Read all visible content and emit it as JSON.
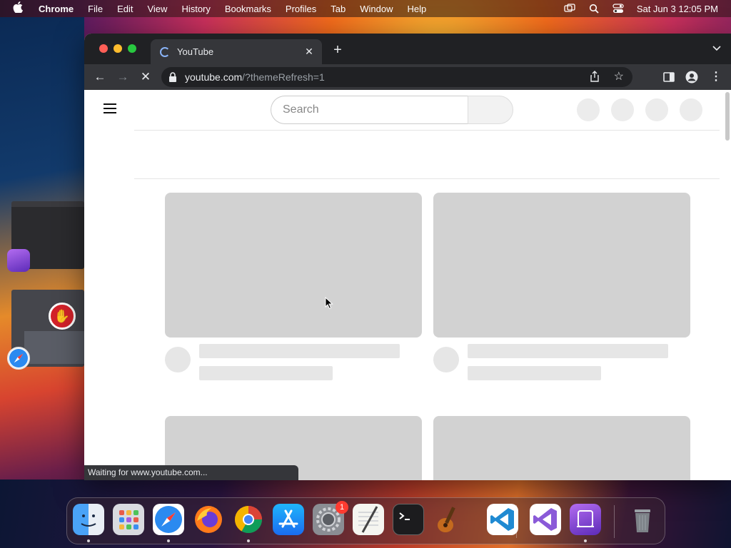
{
  "menubar": {
    "app_name": "Chrome",
    "items": [
      "File",
      "Edit",
      "View",
      "History",
      "Bookmarks",
      "Profiles",
      "Tab",
      "Window",
      "Help"
    ],
    "datetime": "Sat Jun 3  12:05 PM"
  },
  "browser": {
    "tab_title": "YouTube",
    "url_host": "youtube.com",
    "url_path": "/?themeRefresh=1",
    "status_text": "Waiting for www.youtube.com..."
  },
  "page": {
    "search_placeholder": "Search"
  },
  "dock": {
    "apps": [
      "Finder",
      "Launchpad",
      "Safari",
      "Firefox",
      "Google Chrome",
      "App Store",
      "System Settings",
      "TextEdit",
      "Terminal",
      "GarageBand",
      "Visual Studio Code",
      "Visual Studio",
      "Apple Configurator",
      "Trash"
    ],
    "settings_badge": "1"
  },
  "colors": {
    "tab_strip": "#202124",
    "toolbar": "#35363a",
    "skeleton": "#d2d2d2",
    "loading_blue": "#8ab4f8"
  }
}
